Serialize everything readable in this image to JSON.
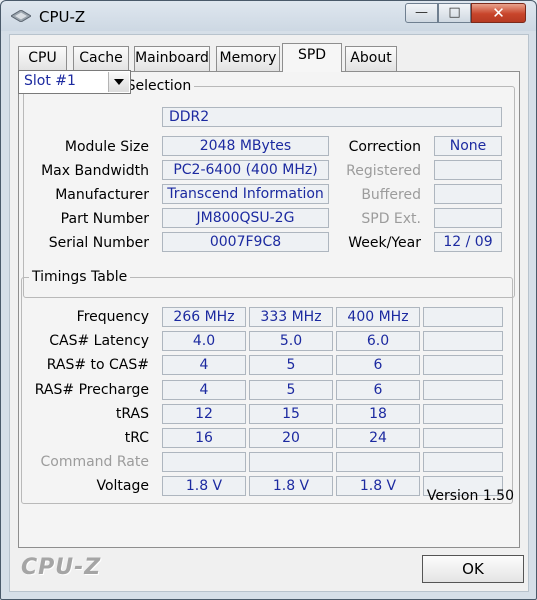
{
  "window": {
    "title": "CPU-Z",
    "controls": {
      "minimize": "—",
      "maximize": "□",
      "close": "✕"
    }
  },
  "tabs": [
    "CPU",
    "Cache",
    "Mainboard",
    "Memory",
    "SPD",
    "About"
  ],
  "active_tab": "SPD",
  "slot_section": {
    "title": "Memory Slot Selection",
    "slot_selected": "Slot #1",
    "memory_type": "DDR2",
    "fields": {
      "module_size": {
        "label": "Module Size",
        "value": "2048 MBytes"
      },
      "max_bandwidth": {
        "label": "Max Bandwidth",
        "value": "PC2-6400 (400 MHz)"
      },
      "manufacturer": {
        "label": "Manufacturer",
        "value": "Transcend Information"
      },
      "part_number": {
        "label": "Part Number",
        "value": "JM800QSU-2G"
      },
      "serial_number": {
        "label": "Serial Number",
        "value": "0007F9C8"
      }
    },
    "right_fields": {
      "correction": {
        "label": "Correction",
        "value": "None"
      },
      "registered": {
        "label": "Registered",
        "value": ""
      },
      "buffered": {
        "label": "Buffered",
        "value": ""
      },
      "spd_ext": {
        "label": "SPD Ext.",
        "value": ""
      },
      "week_year": {
        "label": "Week/Year",
        "value": "12 / 09"
      }
    }
  },
  "timings": {
    "title": "Timings Table",
    "rows": [
      {
        "label": "Frequency",
        "values": [
          "266 MHz",
          "333 MHz",
          "400 MHz",
          ""
        ]
      },
      {
        "label": "CAS# Latency",
        "values": [
          "4.0",
          "5.0",
          "6.0",
          ""
        ]
      },
      {
        "label": "RAS# to CAS#",
        "values": [
          "4",
          "5",
          "6",
          ""
        ]
      },
      {
        "label": "RAS# Precharge",
        "values": [
          "4",
          "5",
          "6",
          ""
        ]
      },
      {
        "label": "tRAS",
        "values": [
          "12",
          "15",
          "18",
          ""
        ]
      },
      {
        "label": "tRC",
        "values": [
          "16",
          "20",
          "24",
          ""
        ]
      },
      {
        "label": "Command Rate",
        "values": [
          "",
          "",
          "",
          ""
        ]
      },
      {
        "label": "Voltage",
        "values": [
          "1.8 V",
          "1.8 V",
          "1.8 V",
          ""
        ]
      }
    ]
  },
  "version": "Version 1.50",
  "footer": {
    "brand": "CPU-Z",
    "ok_label": "OK"
  }
}
